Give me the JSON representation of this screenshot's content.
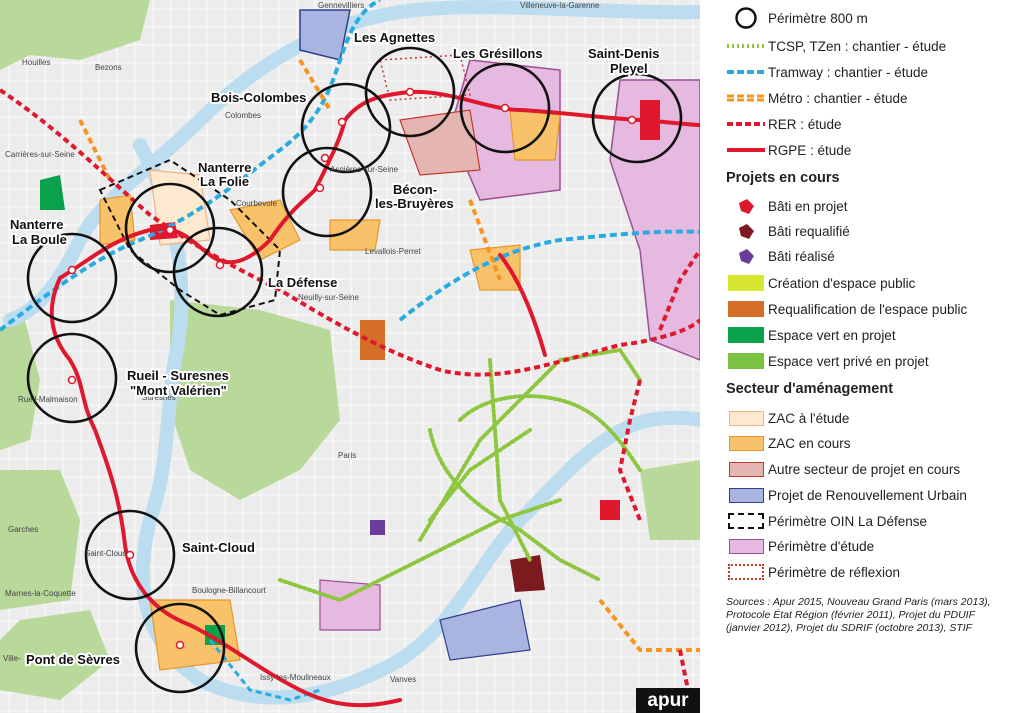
{
  "map": {
    "places": {
      "les_agnettes": "Les Agnettes",
      "les_gresillons": "Les Grésillons",
      "saint_denis_pleyel_1": "Saint-Denis",
      "saint_denis_pleyel_2": "Pleyel",
      "bois_colombes": "Bois-Colombes",
      "nanterre_la_folie_1": "Nanterre",
      "nanterre_la_folie_2": "La Folie",
      "becon_1": "Bécon-",
      "becon_2": "les-Bruyères",
      "nanterre_la_boule_1": "Nanterre",
      "nanterre_la_boule_2": "La Boule",
      "la_defense": "La Défense",
      "rueil_1": "Rueil - Suresnes",
      "rueil_2": "\"Mont Valérien\"",
      "saint_cloud": "Saint-Cloud",
      "pont_de_sevres": "Pont de Sèvres"
    },
    "towns": {
      "gennevilliers": "Gennevilliers",
      "villeneuve": "Villeneuve-la-Garenne",
      "houilles": "Houilles",
      "bezons": "Bezons",
      "colombes": "Colombes",
      "carrieres": "Carrières-sur-Seine",
      "courbevoie": "Courbevoie",
      "levallois": "Levallois-Perret",
      "neuilly": "Neuilly-sur-Seine",
      "asnieres": "Asnières-sur-Seine",
      "rueil_malmaison": "Rueil-Malmaison",
      "suresnes": "Suresnes",
      "paris": "Paris",
      "garches": "Garches",
      "saint_cloud_town": "Saint-Cloud",
      "boulogne": "Boulogne-Billancourt",
      "marnes": "Marnes-la-Coquette",
      "ville": "Ville-",
      "issy": "Issy-les-Moulineaux",
      "vanves": "Vanves"
    },
    "logo": "apur"
  },
  "legend": {
    "perimetre_800m": "Périmètre 800 m",
    "lines": [
      {
        "label": "TCSP, TZen : chantier - étude",
        "color": "#8dc63f",
        "style": "dotted"
      },
      {
        "label": "Tramway : chantier - étude",
        "color": "#29abe2",
        "style": "dashed"
      },
      {
        "label": "Métro : chantier - étude",
        "color": "#f7941d",
        "style": "double-dashed"
      },
      {
        "label": "RER : étude",
        "color": "#e0182d",
        "style": "dashed"
      },
      {
        "label": "RGPE : étude",
        "color": "#e0182d",
        "style": "solid"
      }
    ],
    "projets_title": "Projets en cours",
    "projets": [
      {
        "label": "Bâti en projet",
        "color": "#e0182d",
        "icon": "building-shape"
      },
      {
        "label": "Bâti requalifié",
        "color": "#7b1a1f",
        "icon": "building-shape"
      },
      {
        "label": "Bâti réalisé",
        "color": "#6a3d9a",
        "icon": "building-shape"
      },
      {
        "label": "Création d'espace public",
        "color": "#d7e631",
        "icon": "box"
      },
      {
        "label": "Requalification de l'espace public",
        "color": "#d56f28",
        "icon": "box"
      },
      {
        "label": "Espace vert en projet",
        "color": "#0aa14b",
        "icon": "box"
      },
      {
        "label": "Espace vert privé en projet",
        "color": "#7cc242",
        "icon": "box"
      }
    ],
    "secteur_title": "Secteur d'aménagement",
    "secteurs": [
      {
        "label": "ZAC à l'étude",
        "fill": "#fde9cf",
        "stroke": "#f4b183",
        "style": "solid"
      },
      {
        "label": "ZAC en cours",
        "fill": "#f8c26b",
        "stroke": "#e8962b",
        "style": "solid"
      },
      {
        "label": "Autre secteur de projet en cours",
        "fill": "#e5b5b2",
        "stroke": "#c0392b",
        "style": "solid"
      },
      {
        "label": "Projet de Renouvellement Urbain",
        "fill": "#a9b4e0",
        "stroke": "#2e3f8f",
        "style": "solid"
      },
      {
        "label": "Périmètre OIN La Défense",
        "fill": "#ffffff",
        "stroke": "#111111",
        "style": "dashed"
      },
      {
        "label": "Périmètre d'étude",
        "fill": "#e6b9e0",
        "stroke": "#9b4f96",
        "style": "solid"
      },
      {
        "label": "Périmètre de réflexion",
        "fill": "#ffffff",
        "stroke": "#c0392b",
        "style": "dotted"
      }
    ],
    "sources": "Sources : Apur 2015, Nouveau Grand Paris (mars 2013), Protocole État Région (février 2011), Projet du PDUIF (janvier 2012), Projet du SDRIF (octobre 2013), STIF"
  }
}
